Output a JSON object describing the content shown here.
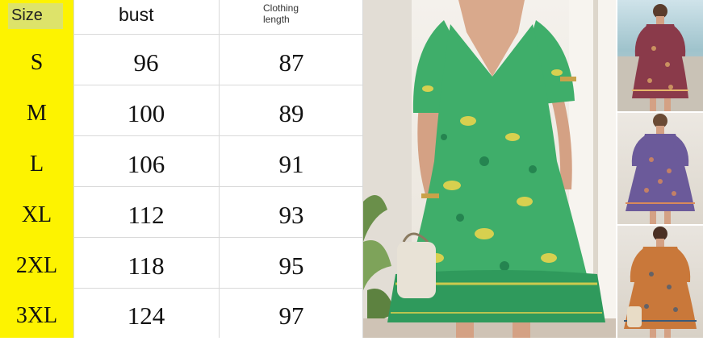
{
  "size_chart": {
    "headers": {
      "size": "Size",
      "bust": "bust",
      "length_line1": "Clothing",
      "length_line2": "length"
    },
    "rows": [
      {
        "size": "S",
        "bust": "96",
        "length": "87"
      },
      {
        "size": "M",
        "bust": "100",
        "length": "89"
      },
      {
        "size": "L",
        "bust": "106",
        "length": "91"
      },
      {
        "size": "XL",
        "bust": "112",
        "length": "93"
      },
      {
        "size": "2XL",
        "bust": "118",
        "length": "95"
      },
      {
        "size": "3XL",
        "bust": "124",
        "length": "97"
      }
    ]
  },
  "colors": {
    "size_column": "#fdf300",
    "header_highlight": "#dde36a",
    "grid": "#d9d9d9",
    "dress_green": "#3fae6a",
    "dress_red": "#8a3a4a",
    "dress_blue": "#6b5a9a",
    "dress_orange": "#c9783a"
  },
  "photos": [
    {
      "name": "main-photo",
      "dress_color": "green paisley"
    },
    {
      "name": "thumb-red",
      "dress_color": "red paisley"
    },
    {
      "name": "thumb-purple",
      "dress_color": "purple paisley"
    },
    {
      "name": "thumb-orange",
      "dress_color": "orange paisley"
    }
  ]
}
